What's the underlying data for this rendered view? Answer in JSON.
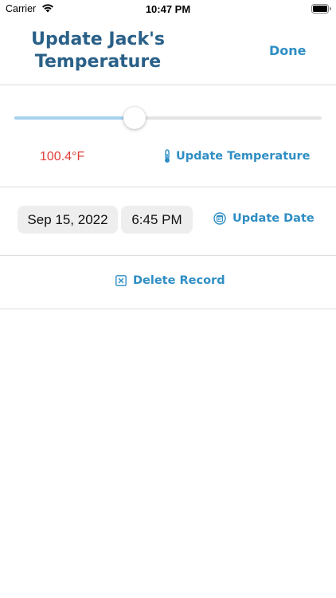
{
  "status_bar": {
    "carrier": "Carrier",
    "time": "10:47 PM",
    "icons": [
      "wifi-icon",
      "battery-icon"
    ]
  },
  "nav": {
    "title": "Update Jack's Temperature",
    "done_label": "Done"
  },
  "temperature": {
    "slider_level": 0.39,
    "value_text": "100.4°F",
    "update_label": "Update Temperature",
    "update_icon": "thermometer-icon"
  },
  "date_section": {
    "date": "Sep 15, 2022",
    "time": "6:45 PM",
    "update_label": "Update Date",
    "update_icon": "calendar-icon"
  },
  "delete": {
    "label": "Delete Record",
    "icon": "xmark-square-icon"
  },
  "colors": {
    "accent": "#2f8ec4",
    "title": "#2a6088",
    "temperature_value": "#e0403a",
    "slider_fill": "#a6d3f0"
  }
}
